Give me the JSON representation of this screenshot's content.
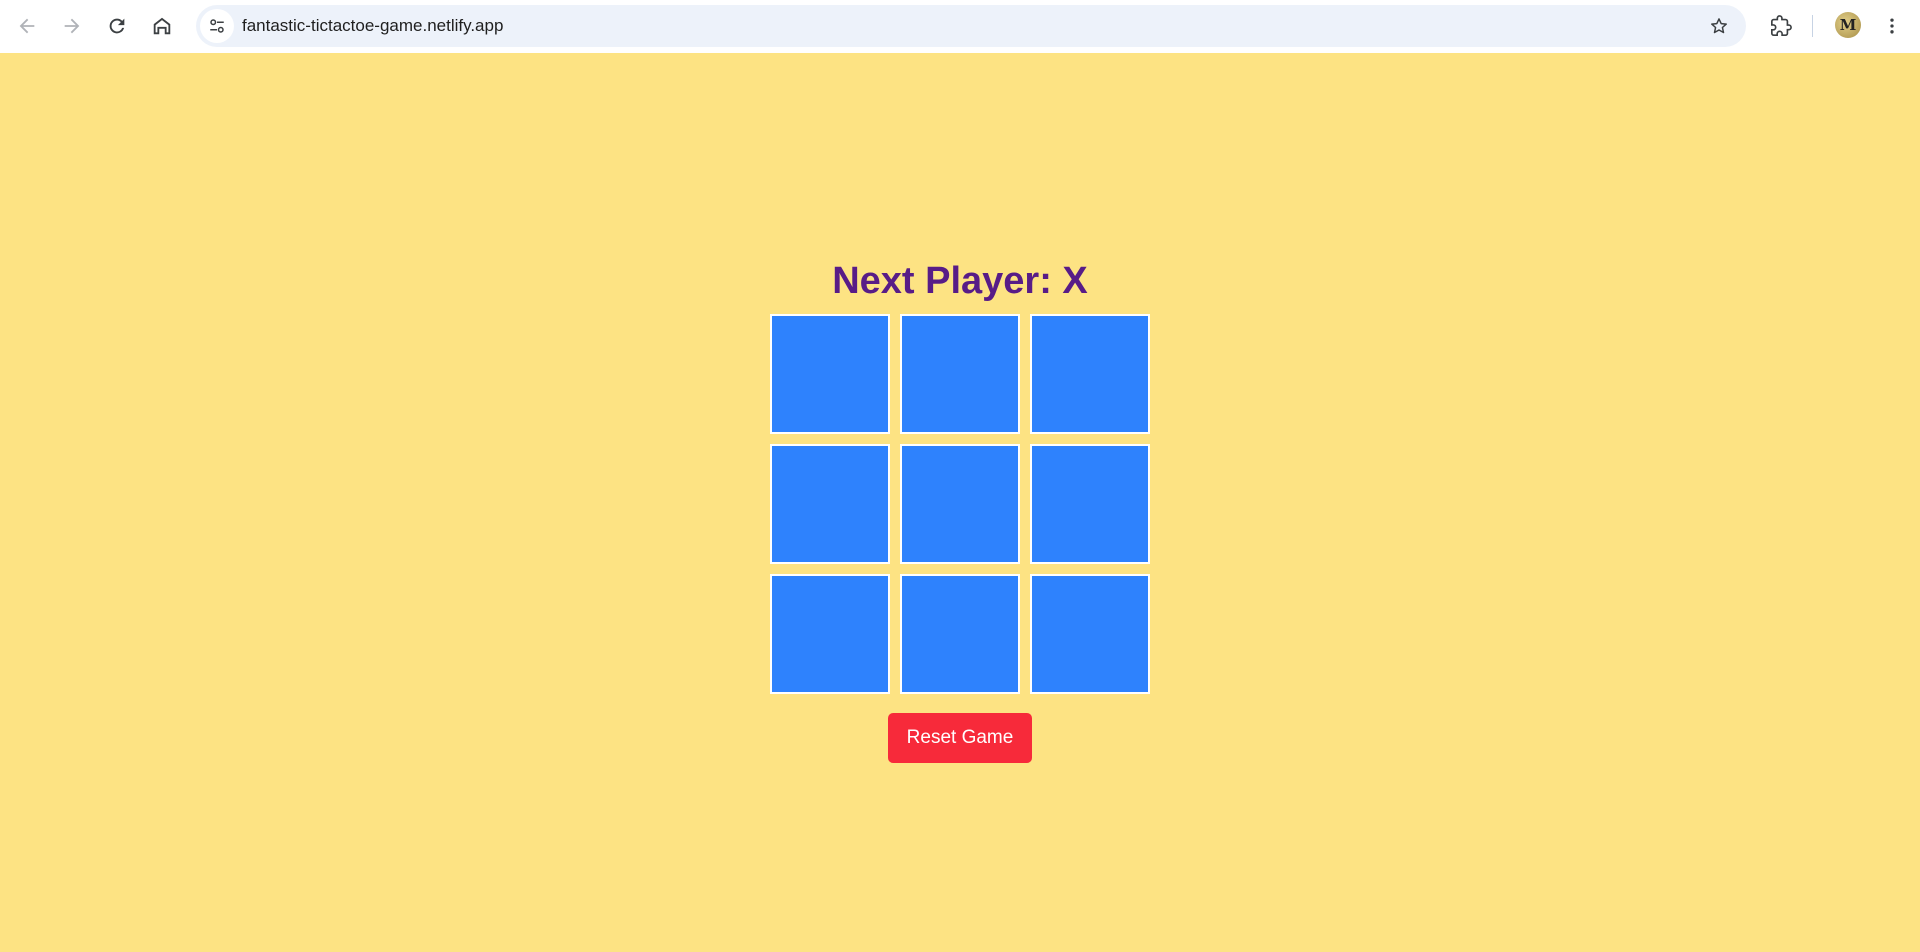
{
  "browser": {
    "url": "fantastic-tictactoe-game.netlify.app",
    "profile_initial": "M",
    "icons": [
      "back-icon",
      "forward-icon",
      "reload-icon",
      "home-icon",
      "site-info-icon",
      "bookmark-star-icon",
      "extensions-icon",
      "kebab-menu-icon"
    ]
  },
  "game": {
    "status": "Next Player: X",
    "board": [
      "",
      "",
      "",
      "",
      "",
      "",
      "",
      "",
      ""
    ],
    "reset_label": "Reset Game"
  },
  "colors": {
    "background": "#fde383",
    "title": "#581c87",
    "cell": "#2e82fd",
    "reset_button": "#f72a3a"
  }
}
